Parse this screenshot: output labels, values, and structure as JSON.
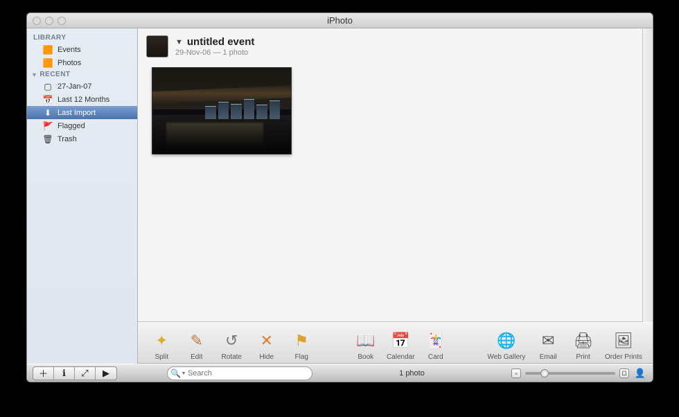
{
  "window": {
    "title": "iPhoto"
  },
  "sidebar": {
    "sections": [
      {
        "label": "LIBRARY",
        "collapsed": false,
        "items": [
          {
            "icon": "events-icon",
            "glyph": "🟧",
            "label": "Events",
            "selected": false
          },
          {
            "icon": "photos-icon",
            "glyph": "🟧",
            "label": "Photos",
            "selected": false
          }
        ]
      },
      {
        "label": "RECENT",
        "collapsed": false,
        "items": [
          {
            "icon": "event-icon",
            "glyph": "▢",
            "label": "27-Jan-07",
            "selected": false
          },
          {
            "icon": "calendar-icon",
            "glyph": "📅",
            "label": "Last 12 Months",
            "selected": false
          },
          {
            "icon": "import-icon",
            "glyph": "⬇",
            "label": "Last Import",
            "selected": true
          },
          {
            "icon": "flag-icon",
            "glyph": "🚩",
            "label": "Flagged",
            "selected": false
          },
          {
            "icon": "trash-icon",
            "glyph": "🗑",
            "label": "Trash",
            "selected": false
          }
        ]
      }
    ]
  },
  "event": {
    "title": "untitled event",
    "subtitle": "29-Nov-06 — 1 photo"
  },
  "toolbar": {
    "groups": [
      [
        {
          "name": "split-button",
          "icon": "✦",
          "label": "Split"
        },
        {
          "name": "edit-button",
          "icon": "✎",
          "label": "Edit"
        },
        {
          "name": "rotate-button",
          "icon": "↺",
          "label": "Rotate"
        },
        {
          "name": "hide-button",
          "icon": "✕",
          "label": "Hide"
        },
        {
          "name": "flag-button",
          "icon": "⚑",
          "label": "Flag"
        }
      ],
      [
        {
          "name": "book-button",
          "icon": "📖",
          "label": "Book"
        },
        {
          "name": "calendar-button",
          "icon": "📅",
          "label": "Calendar"
        },
        {
          "name": "card-button",
          "icon": "🃏",
          "label": "Card"
        }
      ],
      [
        {
          "name": "webgallery-button",
          "icon": "🌐",
          "label": "Web Gallery"
        },
        {
          "name": "email-button",
          "icon": "✉",
          "label": "Email"
        },
        {
          "name": "print-button",
          "icon": "🖨",
          "label": "Print"
        },
        {
          "name": "orderprints-button",
          "icon": "🖼",
          "label": "Order Prints"
        }
      ]
    ]
  },
  "status": {
    "buttons": [
      {
        "name": "add-button",
        "glyph": "＋"
      },
      {
        "name": "info-button",
        "glyph": "ℹ"
      },
      {
        "name": "fullscreen-button",
        "glyph": "⤢"
      },
      {
        "name": "play-button",
        "glyph": "▶"
      }
    ],
    "search_placeholder": "Search",
    "center": "1 photo",
    "zoom_small_glyph": "▫",
    "zoom_large_glyph": "◻",
    "account_glyph": "👤"
  }
}
